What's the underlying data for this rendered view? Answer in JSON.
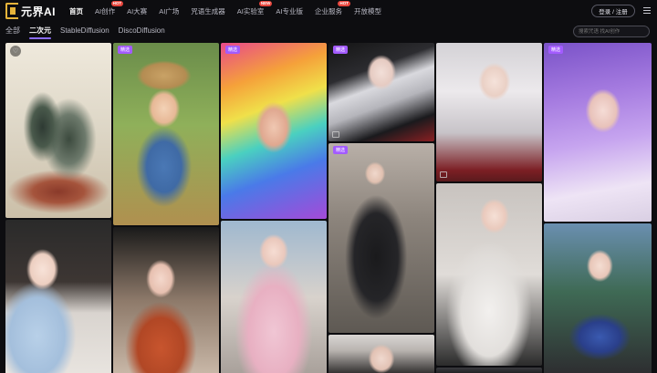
{
  "brand": {
    "logo_text": "元界AI"
  },
  "nav": {
    "items": [
      {
        "label": "首页",
        "badge": "",
        "active": true
      },
      {
        "label": "AI创作",
        "badge": "HOT",
        "active": false
      },
      {
        "label": "AI大赛",
        "badge": "",
        "active": false
      },
      {
        "label": "AI广场",
        "badge": "",
        "active": false
      },
      {
        "label": "咒语生成器",
        "badge": "",
        "active": false
      },
      {
        "label": "AI实验室",
        "badge": "NEW",
        "active": false
      },
      {
        "label": "AI专业版",
        "badge": "",
        "active": false
      },
      {
        "label": "企业服务",
        "badge": "HOT",
        "active": false
      },
      {
        "label": "开放模型",
        "badge": "",
        "active": false
      }
    ],
    "login_label": "登录 / 注册"
  },
  "tabs": {
    "items": [
      {
        "label": "全部",
        "active": false
      },
      {
        "label": "二次元",
        "active": true
      },
      {
        "label": "StableDiffusion",
        "active": false
      },
      {
        "label": "DiscoDiffusion",
        "active": false
      }
    ]
  },
  "search": {
    "placeholder": "搜索咒语 找AI创作"
  },
  "gallery": {
    "tag_label": "精选",
    "cards": [
      {
        "style": "ink",
        "subject": "ink landscape painting",
        "tagged": false,
        "fav": true
      },
      {
        "style": "girl-hat",
        "subject": "girl with straw hat and puppy",
        "tagged": true,
        "fav": false
      },
      {
        "style": "rainbow",
        "subject": "rainbow hair portrait",
        "tagged": true,
        "fav": false
      },
      {
        "style": "white-hair",
        "subject": "white haired girl in uniform",
        "tagged": true,
        "fav": false
      },
      {
        "style": "long-silver",
        "subject": "long silver hair girl",
        "tagged": false,
        "fav": false
      },
      {
        "style": "purple",
        "subject": "purple hair girl",
        "tagged": true,
        "fav": false
      },
      {
        "style": "black-dress",
        "subject": "girl in black dress on chair",
        "tagged": true,
        "fav": false
      },
      {
        "style": "portrait-long",
        "subject": "girl with long brown hair",
        "tagged": false,
        "fav": false
      },
      {
        "style": "hanfu",
        "subject": "girl in red hanfu",
        "tagged": false,
        "fav": false
      },
      {
        "style": "pink-dress",
        "subject": "girl in pink dress",
        "tagged": false,
        "fav": false
      },
      {
        "style": "knit",
        "subject": "silver hair girl in knit top",
        "tagged": false,
        "fav": false
      },
      {
        "style": "tartan",
        "subject": "girl in tartan top",
        "tagged": false,
        "fav": false
      },
      {
        "style": "dark-short",
        "subject": "girl with short hair",
        "tagged": false,
        "fav": false
      }
    ]
  }
}
